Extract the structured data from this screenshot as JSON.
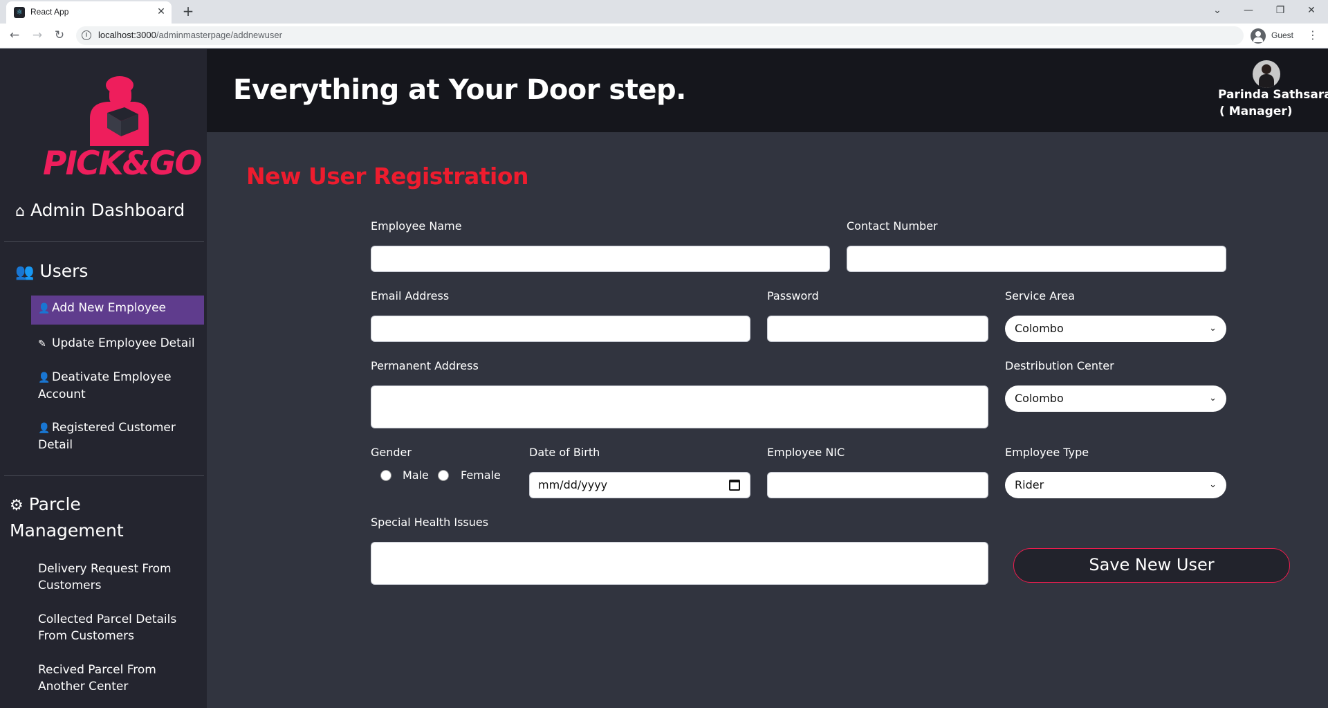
{
  "browser": {
    "tab_title": "React App",
    "tab_close": "✕",
    "new_tab": "+",
    "url_host": "localhost:3000",
    "url_path": "/adminmasterpage/addnewuser",
    "profile_label": "Guest",
    "window_controls": [
      "⌄",
      "—",
      "❐",
      "✕"
    ]
  },
  "brand": {
    "logo_text": "PICK&GO"
  },
  "sidebar": {
    "dashboard_label": "Admin Dashboard",
    "users_heading": "Users",
    "users_items": [
      {
        "label": "Add New Employee",
        "icon": "user-plus-icon",
        "active": true
      },
      {
        "label": "Update Employee Detail",
        "icon": "edit-icon",
        "active": false
      },
      {
        "label": "Deativate Employee Account",
        "icon": "user-minus-icon",
        "active": false
      },
      {
        "label": "Registered Customer Detail",
        "icon": "user-check-icon",
        "active": false
      }
    ],
    "parcel_heading": "Parcle Management",
    "parcel_items": [
      {
        "label": "Delivery Request From Customers"
      },
      {
        "label": "Collected Parcel Details From Customers"
      },
      {
        "label": "Recived Parcel From Another Center"
      }
    ]
  },
  "header": {
    "tagline": "Everything at Your Door step.",
    "user_name": "Parinda Sathsara",
    "user_role": "( Manager)"
  },
  "form": {
    "title": "New User Registration",
    "employee_name_label": "Employee Name",
    "employee_name_value": "",
    "contact_number_label": "Contact Number",
    "contact_number_value": "",
    "email_label": "Email Address",
    "email_value": "",
    "password_label": "Password",
    "password_value": "",
    "service_area_label": "Service Area",
    "service_area_value": "Colombo",
    "permanent_address_label": "Permanent Address",
    "permanent_address_value": "",
    "distribution_center_label": "Destribution Center",
    "distribution_center_value": "Colombo",
    "gender_label": "Gender",
    "gender_options": [
      "Male",
      "Female"
    ],
    "dob_label": "Date of Birth",
    "dob_placeholder": "mm/dd/yyyy",
    "nic_label": "Employee NIC",
    "nic_value": "",
    "employee_type_label": "Employee Type",
    "employee_type_value": "Rider",
    "health_label": "Special Health Issues",
    "health_value": "",
    "save_button": "Save New User"
  },
  "colors": {
    "accent_red": "#ee1c2e",
    "active_item": "#5f3c8d",
    "sidebar_bg": "#24252f",
    "main_bg": "#31343f"
  }
}
